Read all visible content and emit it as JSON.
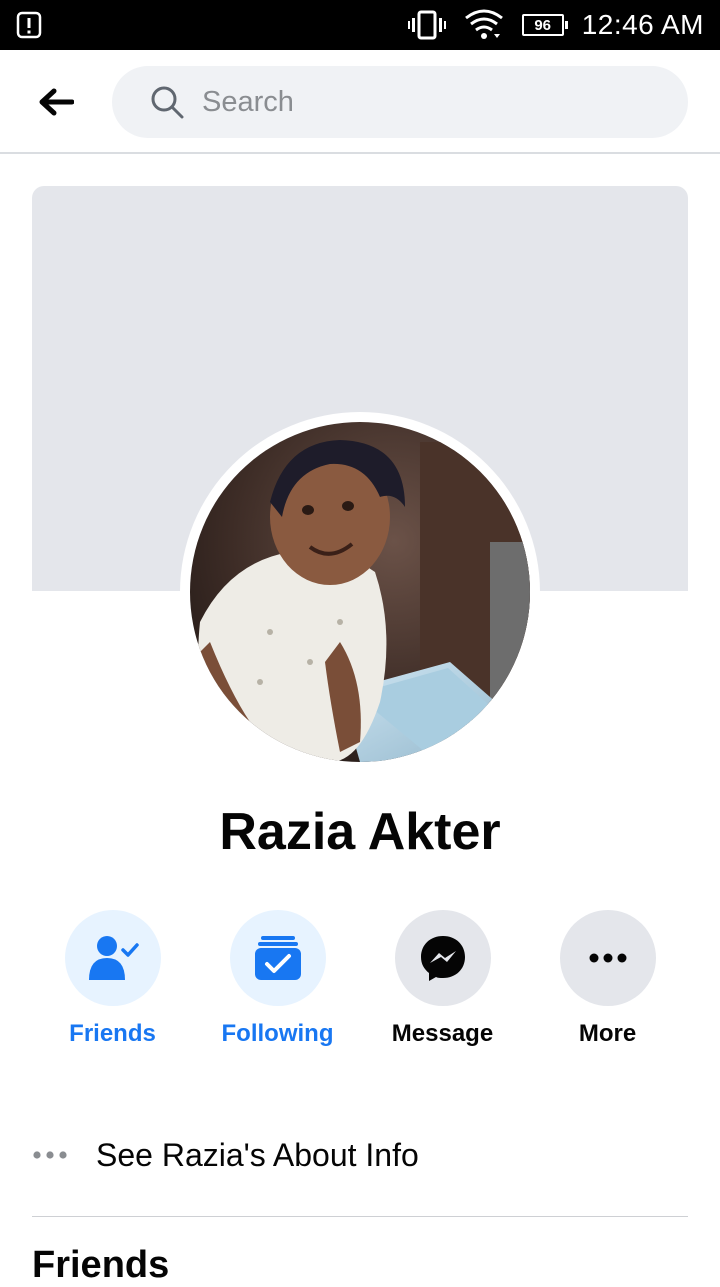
{
  "status_bar": {
    "time": "12:46 AM",
    "battery": "96",
    "icons": [
      "alert-icon",
      "vibrate-icon",
      "wifi-icon",
      "battery-icon"
    ]
  },
  "header": {
    "back_icon": "back-arrow-icon",
    "search": {
      "placeholder": "Search",
      "value": ""
    }
  },
  "profile": {
    "name": "Razia Akter"
  },
  "actions": [
    {
      "label": "Friends",
      "icon": "friends-check-icon",
      "style": "blue"
    },
    {
      "label": "Following",
      "icon": "following-icon",
      "style": "blue"
    },
    {
      "label": "Message",
      "icon": "messenger-icon",
      "style": "gray"
    },
    {
      "label": "More",
      "icon": "more-dots-icon",
      "style": "gray"
    }
  ],
  "about": {
    "label": "See Razia's About Info"
  },
  "sections": {
    "friends_title": "Friends"
  },
  "colors": {
    "accent": "#1877f2",
    "accent_light": "#e7f3ff",
    "gray_bg": "#e4e6eb",
    "search_bg": "#f0f2f5"
  }
}
